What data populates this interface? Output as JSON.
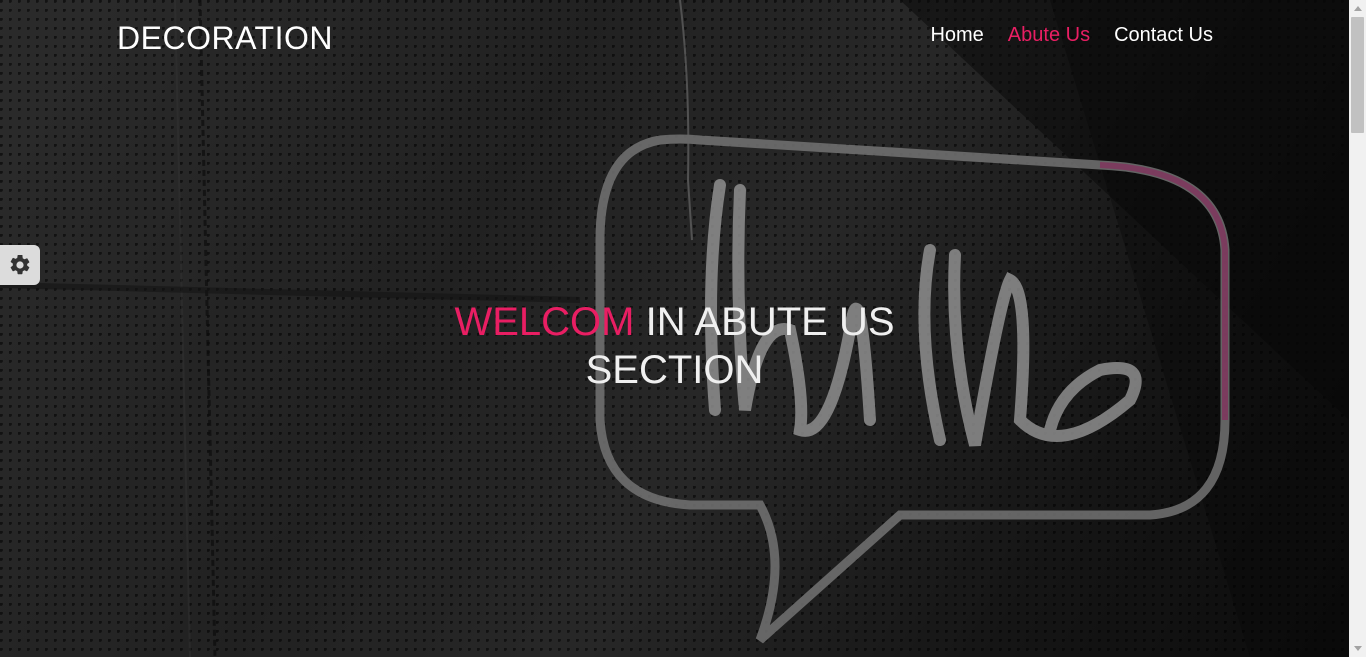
{
  "header": {
    "logo": "DECORATION",
    "nav": [
      {
        "label": "Home",
        "active": false
      },
      {
        "label": "Abute Us",
        "active": true
      },
      {
        "label": "Contact Us",
        "active": false
      }
    ]
  },
  "hero": {
    "title_accent": "WELCOM",
    "title_rest": " IN ABUTE US SECTION"
  },
  "settings": {
    "icon": "gear-icon"
  },
  "colors": {
    "accent": "#e91e63",
    "text": "#ffffff"
  }
}
